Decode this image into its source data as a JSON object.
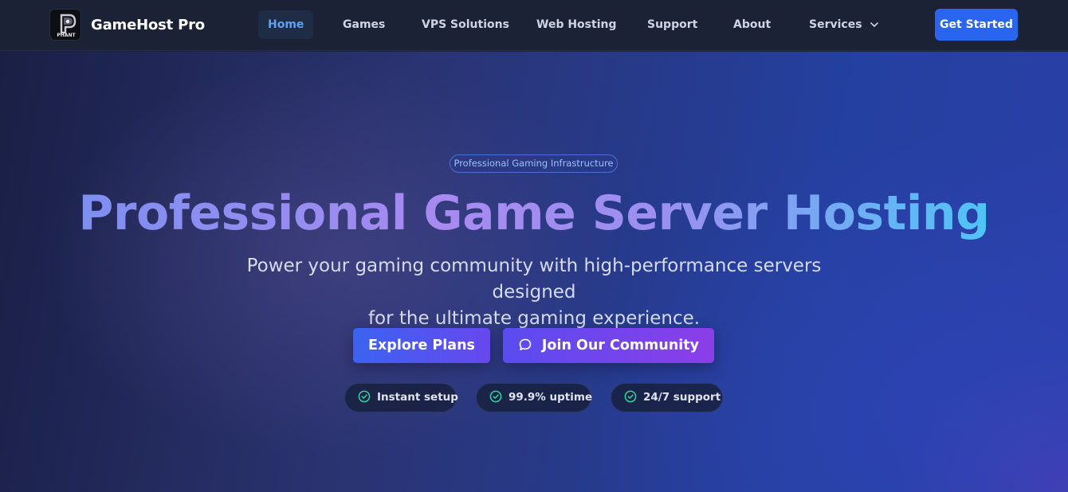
{
  "brand": {
    "name": "GameHost Pro",
    "logo_text": "PHANT",
    "logo_icon": "phantom-logo-icon"
  },
  "nav": {
    "items": [
      {
        "label": "Home",
        "active": true
      },
      {
        "label": "Games"
      },
      {
        "label": "VPS Solutions"
      },
      {
        "label": "Web Hosting"
      },
      {
        "label": "Support"
      },
      {
        "label": "About"
      },
      {
        "label": "Services",
        "icon": "chevron-down-icon"
      }
    ],
    "cta_label": "Get Started"
  },
  "hero": {
    "badge": "Professional Gaming Infrastructure",
    "headline": "Professional Game Server Hosting",
    "subtitle_line1": "Power your gaming community with high-performance servers designed",
    "subtitle_line2": "for the ultimate gaming experience.",
    "primary_button": "Explore Plans",
    "secondary_button": "Join Our Community",
    "secondary_button_icon": "chat-bubble-icon",
    "features": [
      {
        "label": "Instant setup",
        "icon": "check-circle-icon"
      },
      {
        "label": "99.9% uptime",
        "icon": "check-circle-icon"
      },
      {
        "label": "24/7 support",
        "icon": "check-circle-icon"
      }
    ]
  },
  "colors": {
    "nav_bg": "#1c2236",
    "accent_blue": "#2a65f0",
    "active_link": "#5fa0f2",
    "check_green": "#34d399"
  }
}
